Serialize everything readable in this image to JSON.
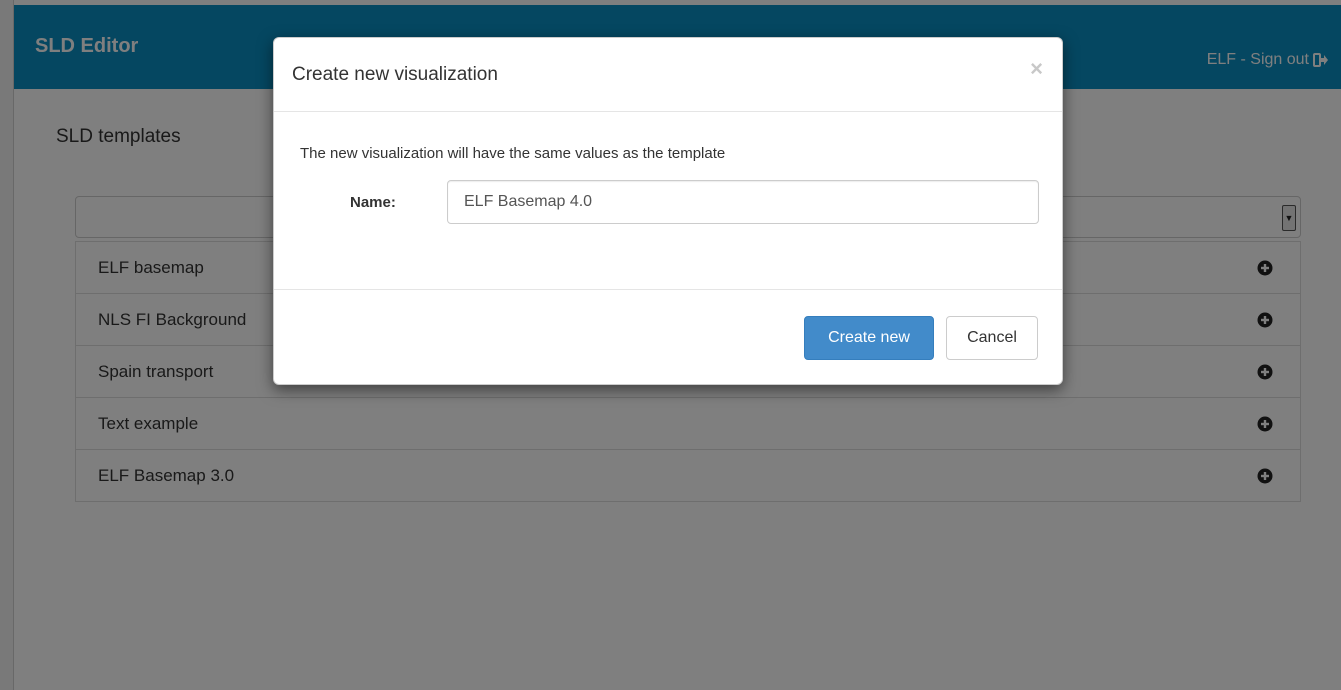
{
  "header": {
    "brand": "SLD Editor",
    "signout_label": "ELF - Sign out"
  },
  "main": {
    "title": "SLD templates",
    "templates": [
      {
        "label": "ELF basemap"
      },
      {
        "label": "NLS FI Background"
      },
      {
        "label": "Spain transport"
      },
      {
        "label": "Text example"
      },
      {
        "label": "ELF Basemap 3.0"
      }
    ]
  },
  "modal": {
    "title": "Create new visualization",
    "close_label": "×",
    "description": "The new visualization will have the same values as the template",
    "name_label": "Name:",
    "name_value": "ELF Basemap 4.0",
    "create_label": "Create new",
    "cancel_label": "Cancel"
  },
  "colors": {
    "navbar": "#0b8fc3",
    "primary": "#428bca"
  },
  "icons": {
    "signout": "sign-out-icon",
    "add": "plus-circle-icon",
    "select": "dropdown-arrow-icon"
  }
}
